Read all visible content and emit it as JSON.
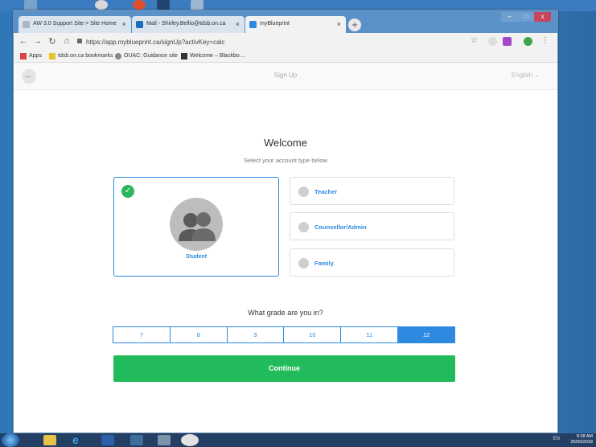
{
  "browser": {
    "tabs": [
      {
        "label": "AW 3.0 Support Site > Site Home",
        "active": false
      },
      {
        "label": "Mail - Shirley.Bellio@tdsb.on.ca",
        "active": false
      },
      {
        "label": "myBlueprint",
        "active": true
      }
    ],
    "new_tab": "+",
    "url": "https://app.myblueprint.ca/signUp?activKey=calc",
    "bookmarks": [
      "Apps",
      "tdsb.on.ca bookmarks",
      "OUAC: Guidance site",
      "Welcome – Blackbo…"
    ],
    "window_controls": {
      "minimize": "–",
      "maximize": "□",
      "close": "x"
    }
  },
  "page": {
    "header": {
      "back": "←",
      "title": "Sign Up",
      "language": "English"
    },
    "welcome": "Welcome",
    "subtitle": "Select your account type below",
    "account_types": {
      "selected": {
        "label": "Student",
        "check": "✓"
      },
      "others": [
        {
          "label": "Teacher",
          "icon": "apple-icon"
        },
        {
          "label": "Counsellor/Admin",
          "icon": "bookmark-icon"
        },
        {
          "label": "Family",
          "icon": "house-icon"
        }
      ]
    },
    "grade_question": "What grade are you in?",
    "grades": [
      "7",
      "8",
      "9",
      "10",
      "11",
      "12"
    ],
    "selected_grade": "12",
    "continue": "Continue"
  },
  "taskbar": {
    "tray": "EN",
    "time": "8:38 AM",
    "date": "20/09/2018"
  },
  "colors": {
    "accent": "#2d8ae0",
    "continue": "#22bb5b",
    "check": "#2cb55c"
  }
}
